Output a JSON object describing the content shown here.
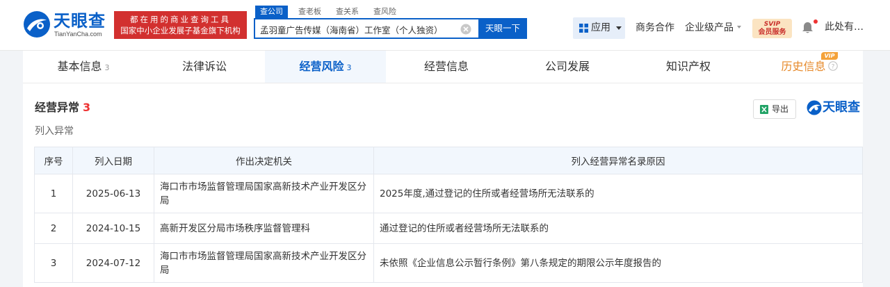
{
  "header": {
    "logo_cn": "天眼查",
    "logo_en": "TianYanCha.com",
    "slogan_line1": "都在用的商业查询工具",
    "slogan_line2": "国家中小企业发展子基金旗下机构",
    "search_tabs": [
      "查公司",
      "查老板",
      "查关系",
      "查风险"
    ],
    "search_value": "孟羽童广告传媒（海南省）工作室（个人独资）",
    "search_button": "天眼一下",
    "app_label": "应用",
    "nav_links": [
      "商务合作",
      "企业级产品"
    ],
    "vip_top": "SVIP",
    "vip_bottom": "会员服务",
    "user_name": "此处有…"
  },
  "tabs": [
    {
      "label": "基本信息",
      "count": "3"
    },
    {
      "label": "法律诉讼",
      "count": ""
    },
    {
      "label": "经营风险",
      "count": "3"
    },
    {
      "label": "经营信息",
      "count": ""
    },
    {
      "label": "公司发展",
      "count": ""
    },
    {
      "label": "知识产权",
      "count": ""
    },
    {
      "label": "历史信息",
      "count": ""
    }
  ],
  "vip_badge": "VIP",
  "section": {
    "title": "经营异常",
    "count": "3",
    "subtitle": "列入异常",
    "export_label": "导出",
    "brand": "天眼查"
  },
  "table": {
    "headers": [
      "序号",
      "列入日期",
      "作出决定机关",
      "列入经营异常名录原因"
    ],
    "rows": [
      {
        "no": "1",
        "date": "2025-06-13",
        "authority": "海口市市场监督管理局国家高新技术产业开发区分局",
        "reason": "2025年度,通过登记的住所或者经营场所无法联系的"
      },
      {
        "no": "2",
        "date": "2024-10-15",
        "authority": "高新开发区分局市场秩序监督管理科",
        "reason": "通过登记的住所或者经营场所无法联系的"
      },
      {
        "no": "3",
        "date": "2024-07-12",
        "authority": "海口市市场监督管理局国家高新技术产业开发区分局",
        "reason": "未依照《企业信息公示暂行条例》第八条规定的期限公示年度报告的"
      }
    ]
  },
  "colors": {
    "brand_blue": "#0a60c8",
    "alert_red": "#e33",
    "history_orange": "#e6892a"
  }
}
